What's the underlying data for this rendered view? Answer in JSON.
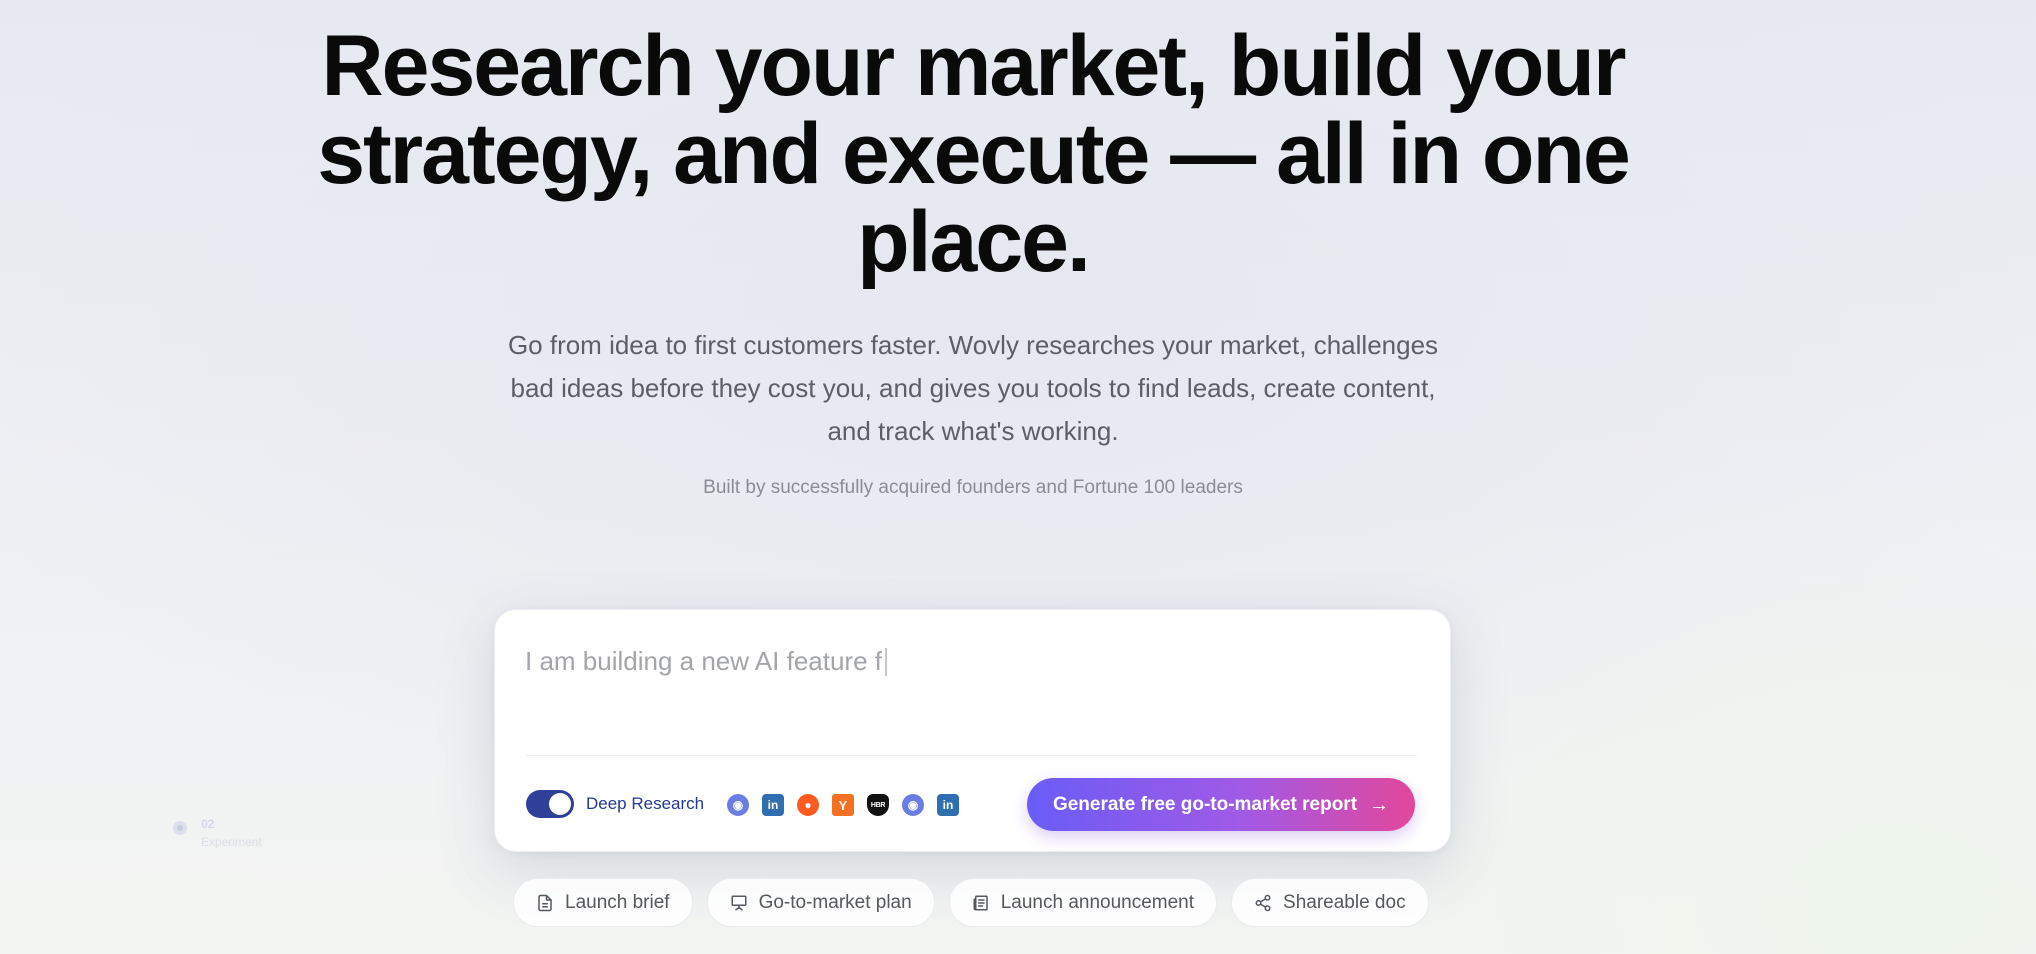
{
  "hero": {
    "title_lines": [
      "Research your market, build your",
      "strategy, and execute — all in one",
      "place."
    ],
    "subtitle_lines": [
      "Go from idea to first customers faster. Wovly researches your market, challenges",
      "bad ideas before they cost you, and gives you tools to find leads, create content,",
      "and track what's working."
    ],
    "credential": "Built by successfully acquired founders and Fortune 100 leaders"
  },
  "prompt": {
    "value": "I am building a new AI feature f",
    "deep_research": {
      "label": "Deep Research",
      "enabled": true
    },
    "sources": [
      {
        "icon": "discord-icon",
        "glyph": "◉"
      },
      {
        "icon": "linkedin-icon",
        "glyph": "in"
      },
      {
        "icon": "reddit-icon",
        "glyph": "●"
      },
      {
        "icon": "hacker-news-icon",
        "glyph": "Y"
      },
      {
        "icon": "hbr-icon",
        "glyph": "HBR"
      },
      {
        "icon": "discord-icon",
        "glyph": "◉"
      },
      {
        "icon": "linkedin-icon",
        "glyph": "in"
      }
    ],
    "cta_label": "Generate free go-to-market report",
    "cta_gradient": [
      "#6a5cf6",
      "#e2479b"
    ]
  },
  "chips": [
    {
      "label": "Launch brief",
      "icon": "document-icon"
    },
    {
      "label": "Go-to-market plan",
      "icon": "presentation-icon"
    },
    {
      "label": "Launch announcement",
      "icon": "newspaper-icon"
    },
    {
      "label": "Shareable doc",
      "icon": "share-icon"
    }
  ],
  "experiment_badge": {
    "code": "02",
    "label": "Experiment"
  },
  "colors": {
    "accent": "#2f3f9a",
    "heading": "#0a0a0a",
    "muted": "#5c5f66"
  }
}
